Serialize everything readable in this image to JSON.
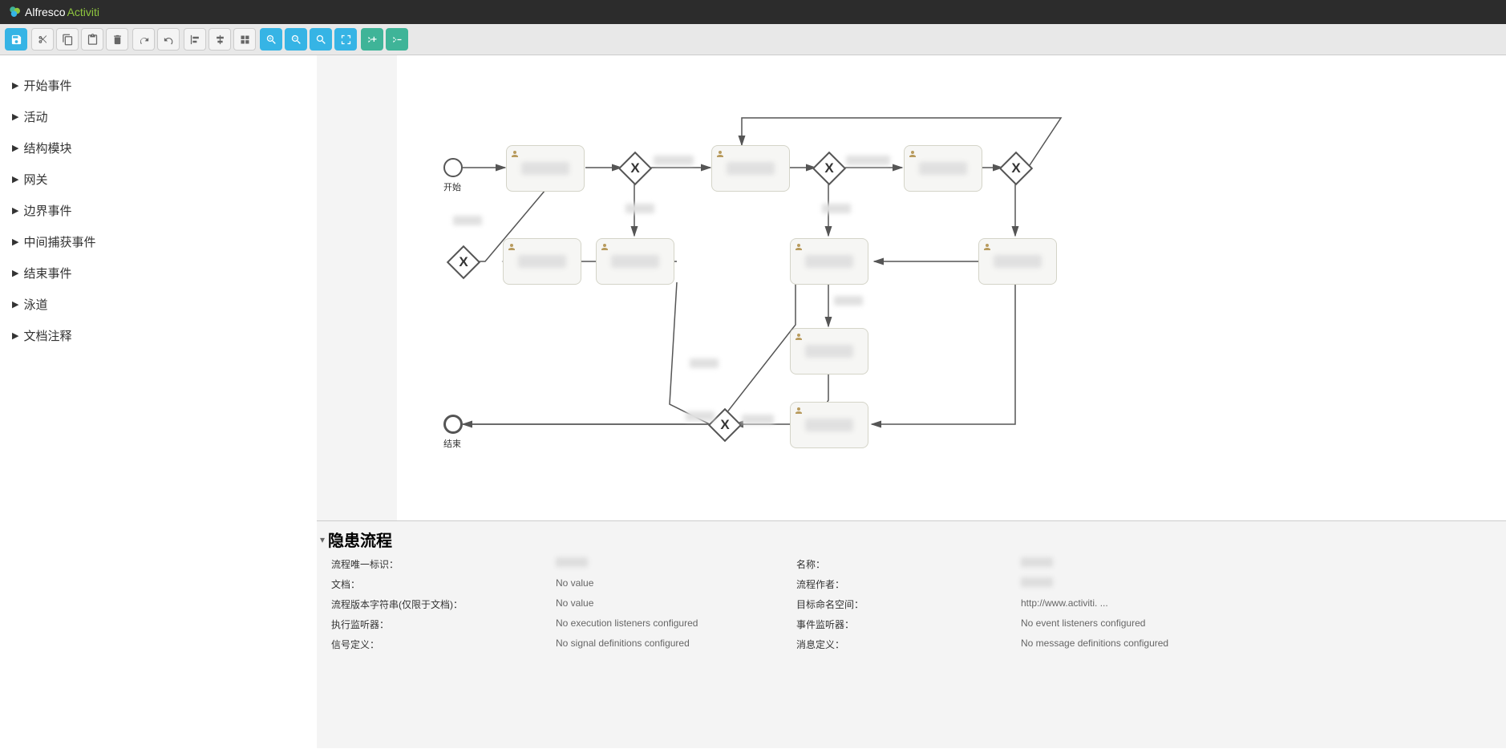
{
  "brand": {
    "part1": "Alfresco",
    "part2": "Activiti"
  },
  "sidebar": {
    "items": [
      {
        "label": "开始事件"
      },
      {
        "label": "活动"
      },
      {
        "label": "结构模块"
      },
      {
        "label": "网关"
      },
      {
        "label": "边界事件"
      },
      {
        "label": "中间捕获事件"
      },
      {
        "label": "结束事件"
      },
      {
        "label": "泳道"
      },
      {
        "label": "文档注释"
      }
    ]
  },
  "canvas": {
    "start_label": "开始",
    "end_label": "结束"
  },
  "properties": {
    "title": "隐患流程",
    "rows": [
      {
        "l1": "流程唯一标识：",
        "v1": "",
        "l2": "名称：",
        "v2": ""
      },
      {
        "l1": "文档：",
        "v1": "No value",
        "l2": "流程作者：",
        "v2": ""
      },
      {
        "l1": "流程版本字符串(仅限于文档)：",
        "v1": "No value",
        "l2": "目标命名空间：",
        "v2": "http://www.activiti. ..."
      },
      {
        "l1": "执行监听器：",
        "v1": "No execution listeners configured",
        "l2": "事件监听器：",
        "v2": "No event listeners configured"
      },
      {
        "l1": "信号定义：",
        "v1": "No signal definitions configured",
        "l2": "消息定义：",
        "v2": "No message definitions configured"
      }
    ]
  }
}
